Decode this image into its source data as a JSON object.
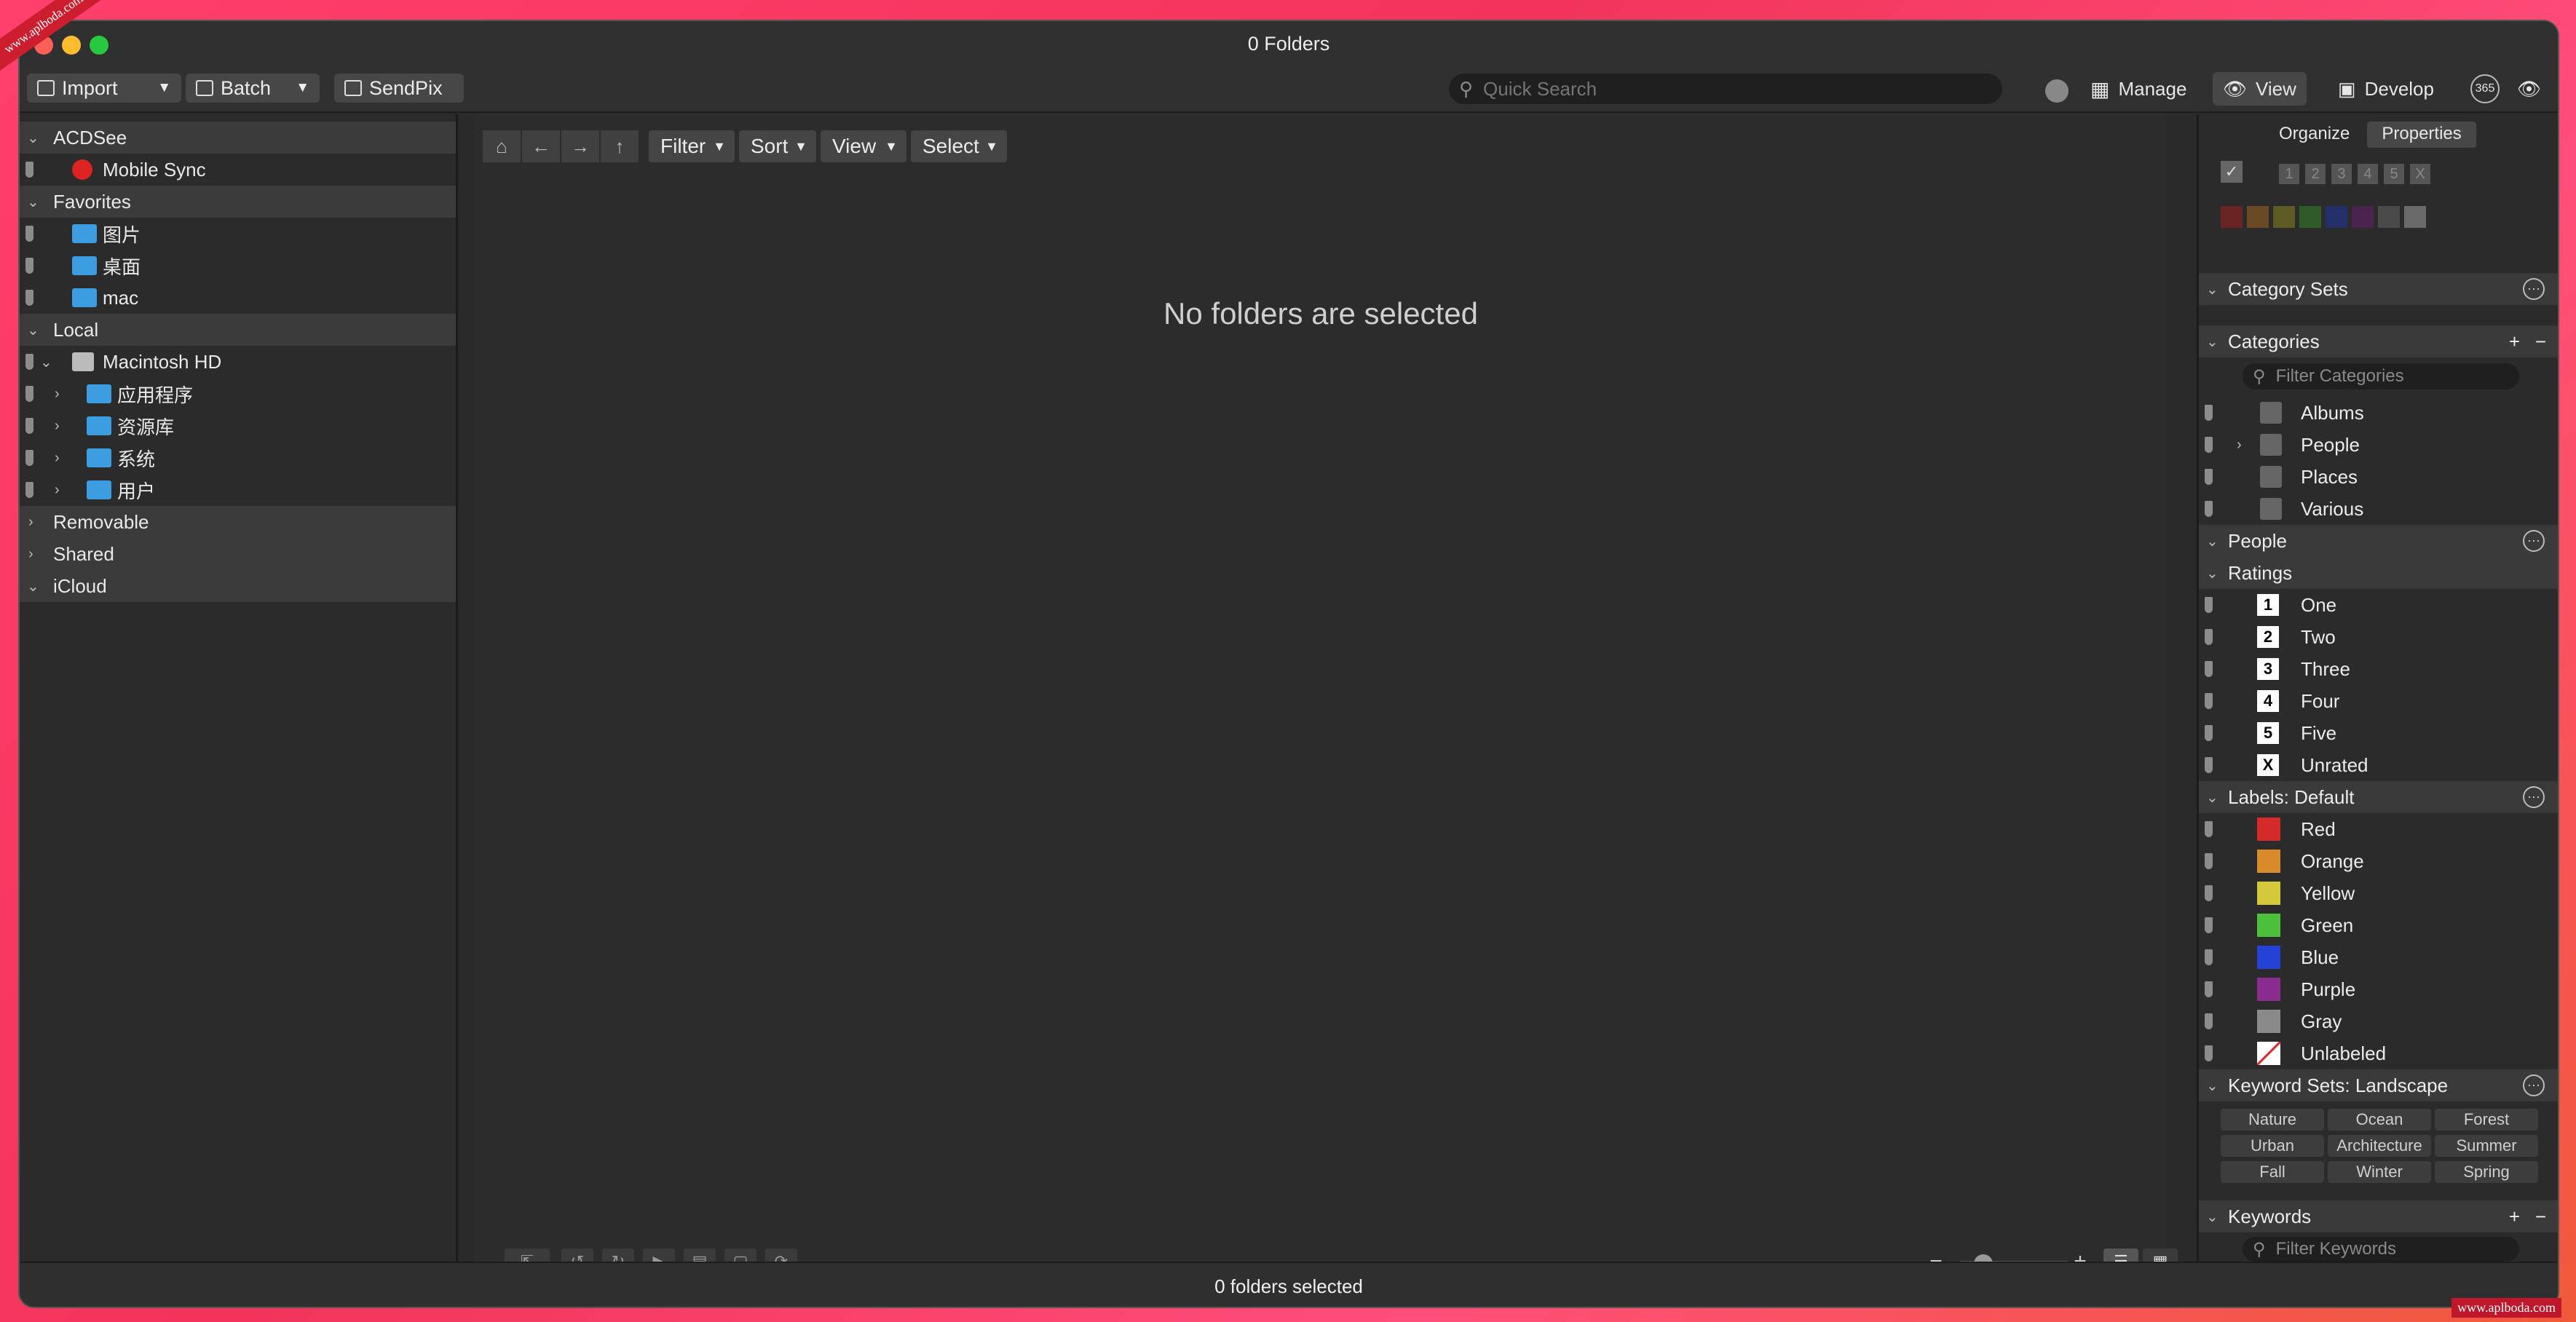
{
  "window": {
    "title": "0 Folders",
    "status": "0 folders selected"
  },
  "watermark": "www.aplboda.com",
  "toolbar": {
    "import": "Import",
    "batch": "Batch",
    "sendpix": "SendPix",
    "search_placeholder": "Quick Search",
    "manage": "Manage",
    "view": "View",
    "develop": "Develop",
    "badge365": "365"
  },
  "left": {
    "acdsee": "ACDSee",
    "mobile_sync": "Mobile Sync",
    "favorites": "Favorites",
    "fav_items": [
      "图片",
      "桌面",
      "mac"
    ],
    "local": "Local",
    "macintosh": "Macintosh HD",
    "mac_items": [
      "应用程序",
      "资源库",
      "系统",
      "用户"
    ],
    "removable": "Removable",
    "shared": "Shared",
    "icloud": "iCloud"
  },
  "center": {
    "filter": "Filter",
    "sort": "Sort",
    "view": "View",
    "select": "Select",
    "empty": "No folders are selected"
  },
  "right": {
    "tab_organize": "Organize",
    "tab_properties": "Properties",
    "rating_nums": [
      "1",
      "2",
      "3",
      "4",
      "5",
      "X"
    ],
    "category_sets": "Category Sets",
    "categories": "Categories",
    "filter_categories": "Filter Categories",
    "cat_items": [
      "Albums",
      "People",
      "Places",
      "Various"
    ],
    "people": "People",
    "ratings": "Ratings",
    "rating_items": [
      {
        "n": "1",
        "l": "One"
      },
      {
        "n": "2",
        "l": "Two"
      },
      {
        "n": "3",
        "l": "Three"
      },
      {
        "n": "4",
        "l": "Four"
      },
      {
        "n": "5",
        "l": "Five"
      },
      {
        "n": "X",
        "l": "Unrated"
      }
    ],
    "labels": "Labels: Default",
    "label_items": [
      {
        "l": "Red",
        "c": "#d42a2a"
      },
      {
        "l": "Orange",
        "c": "#d98a2b"
      },
      {
        "l": "Yellow",
        "c": "#d4c93a"
      },
      {
        "l": "Green",
        "c": "#4cbf3d"
      },
      {
        "l": "Blue",
        "c": "#2442d6"
      },
      {
        "l": "Purple",
        "c": "#8a2c8f"
      },
      {
        "l": "Gray",
        "c": "#8a8a8a"
      },
      {
        "l": "Unlabeled",
        "c": "#ffffff"
      }
    ],
    "keyword_sets": "Keyword Sets: Landscape",
    "kw": [
      "Nature",
      "Ocean",
      "Forest",
      "Urban",
      "Architecture",
      "Summer",
      "Fall",
      "Winter",
      "Spring"
    ],
    "keywords": "Keywords",
    "filter_keywords": "Filter Keywords"
  }
}
